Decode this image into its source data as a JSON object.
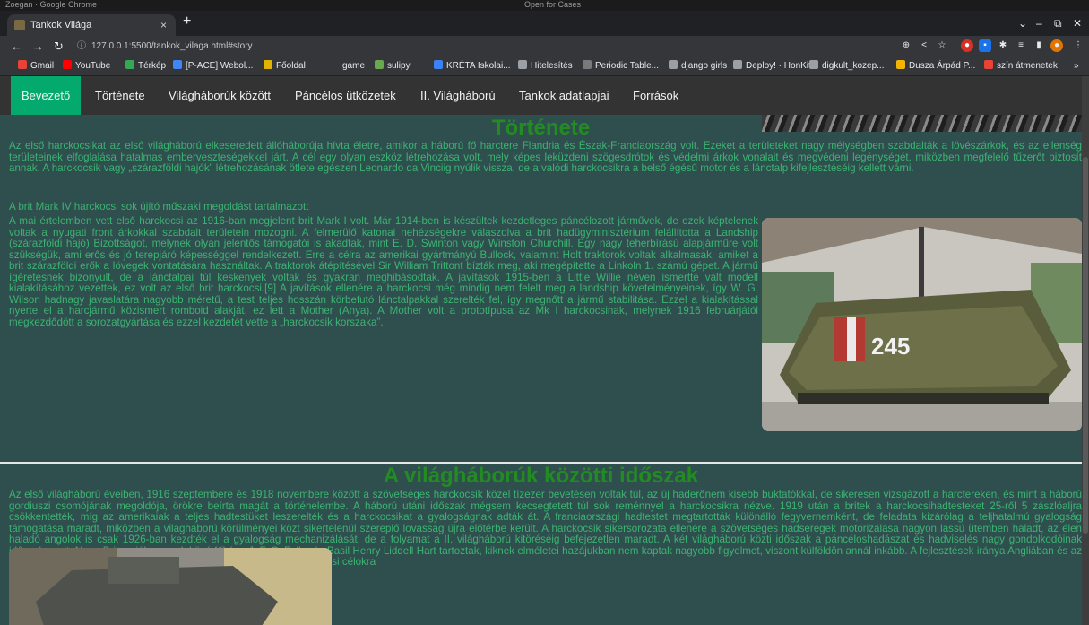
{
  "browser": {
    "top_left": "Zoegan · Google Chrome",
    "top_center": "Open for Cases",
    "tab_title": "Tankok Világa",
    "tab_close": "×",
    "new_tab": "+",
    "url": "127.0.0.1:5500/tankok_vilaga.html#story",
    "bookmarks": [
      {
        "label": "Gmail",
        "color": "#ea4335"
      },
      {
        "label": "YouTube",
        "color": "#ff0000"
      },
      {
        "label": "Térkép",
        "color": "#34a853"
      },
      {
        "label": "[P-ACE] Webol...",
        "color": "#4285f4"
      },
      {
        "label": "Főoldal",
        "color": "#e0b400"
      },
      {
        "label": "game",
        "color": "#35363a"
      },
      {
        "label": "sulipy",
        "color": "#6aa84f"
      },
      {
        "label": "KRÉTA Iskolai...",
        "color": "#3b82f6"
      },
      {
        "label": "Hitelesítés",
        "color": "#9aa0a6"
      },
      {
        "label": "Periodic Table...",
        "color": "#7a7a7a"
      },
      {
        "label": "django girls",
        "color": "#9aa0a6"
      },
      {
        "label": "Deploy! · HonKit",
        "color": "#9aa0a6"
      },
      {
        "label": "digkult_kozep...",
        "color": "#9aa0a6"
      },
      {
        "label": "Dusza Árpád P...",
        "color": "#f4b400"
      },
      {
        "label": "szín átmenetek",
        "color": "#ea4335"
      },
      {
        "label": "»",
        "color": "#35363a"
      }
    ]
  },
  "nav": {
    "items": [
      "Bevezető",
      "Története",
      "Világháborúk között",
      "Páncélos ütközetek",
      "II. Világháború",
      "Tankok adatlapjai",
      "Források"
    ],
    "active_color": "#04aa6d"
  },
  "story": {
    "title": "Története",
    "para1": "Az első harckocsikat az első világháború elkeseredett állóháborúja hívta életre, amikor a háború fő harctere Flandria és Észak-Franciaország volt. Ezeket a területeket nagy mélységben szabdalták a lövészárkok, és az ellenség területeinek elfoglalása hatalmas emberveszteségekkel járt. A cél egy olyan eszköz létrehozása volt, mely képes leküzdeni szögesdrótok és védelmi árkok vonalait és megvédeni legénységét, miközben megfelelő tűzerőt biztosít annak. A harckocsik vagy „szárazföldi hajók” létrehozásának ötlete egészen Leonardo da Vinciig nyúlik vissza, de a valódi harckocsikra a belső égésű motor és a lánctalp kifejlesztéséig kellett várni.",
    "para2": "A brit Mark IV harckocsi sok újító műszaki megoldást tartalmazott",
    "para3": "A mai értelemben vett első harckocsi az 1916-ban megjelent brit Mark I volt. Már 1914-ben is készültek kezdetleges páncélozott járművek, de ezek képtelenek voltak a nyugati front árkokkal szabdalt területein mozogni. A felmerülő katonai nehézségekre válaszolva a brit hadügyminisztérium felállította a Landship (szárazföldi hajó) Bizottságot, melynek olyan jelentős támogatói is akadtak, mint E. D. Swinton vagy Winston Churchill. Egy nagy teherbírású alapjárműre volt szükségük, ami erős és jó terepjáró képességgel rendelkezett. Erre a célra az amerikai gyártmányú Bullock, valamint Holt traktorok voltak alkalmasak, amiket a brit szárazföldi erők a lövegek vontatására használtak. A traktorok átépítésével Sir William Trittont bízták meg, aki megépítette a Linkoln 1. számú gépet. A jármű ígéretesnek bizonyult, de a lánctalpai túl keskenyek voltak és gyakran meghibásodtak. A javítások 1915-ben a Little Willie néven ismertté vált modell kialakításához vezettek, ez volt az első brit harckocsi.[9] A javítások ellenére a harckocsi még mindig nem felelt meg a landship követelményeinek, így W. G. Wilson hadnagy javaslatára nagyobb méretű, a test teljes hosszán körbefutó lánctalpakkal szerelték fel, így megnőtt a jármű stabilitása. Ezzel a kialakítással nyerte el a harcjármű közismert romboid alakját, ez lett a Mother (Anya). A Mother volt a prototípusa az Mk I harckocsinak, melynek 1916 februárjától megkezdődött a sorozatgyártása és ezzel kezdetét vette a „harckocsik korszaka”.",
    "tank_number": "245"
  },
  "interwar": {
    "title": "A világháborúk közötti időszak",
    "para1": "Az első világháború éveiben, 1916 szeptembere és 1918 novembere között a szövetséges harckocsik közel tízezer bevetésen voltak túl, az új haderőnem kisebb buktatókkal, de sikeresen vizsgázott a harctereken, és mint a háború gordiuszi csomójának megoldója, örökre beírta magát a történelembe. A háború utáni időszak mégsem kecsegtetett túl sok reménnyel a harckocsikra nézve. 1919 után a britek a harckocsihadtesteket 25-ről 5 zászlóaljra csökkentették, míg az amerikaiak a teljes hadtestüket leszerelték és a harckocsikat a gyalogságnak adták át. A franciaországi hadtestet megtartották különálló fegyvernemként, de feladata kizárólag a teljhatalmú gyalogság támogatása maradt, miközben a világháború körülményei közt sikertelenül szereplő lovasság újra előtérbe került. A harckocsik sikersorozata ellenére a szövetséges hadseregek motorizálása nagyon lassú ütemben haladt, az élen haladó angolok is csak 1926-ban kezdték el a gyalogság mechanizálását, de a folyamat a II. világháború kitöréséig befejezetlen maradt. A két világháború közti időszak a páncéloshadászat és hadviselés nagy gondolkodóinak időszaka volt, Nagy-Britanniában ezek közé főképp J. F. C. Fuller és Basil Henry Liddell Hart tartoztak, kiknek elméletei hazájukban nem kaptak nagyobb figyelmet, viszont külföldön annál inkább. A fejlesztések iránya Angliában és az Egyesült Államokban a kisméretű, alacsony költségű, a főként kiképzési célokra"
  }
}
